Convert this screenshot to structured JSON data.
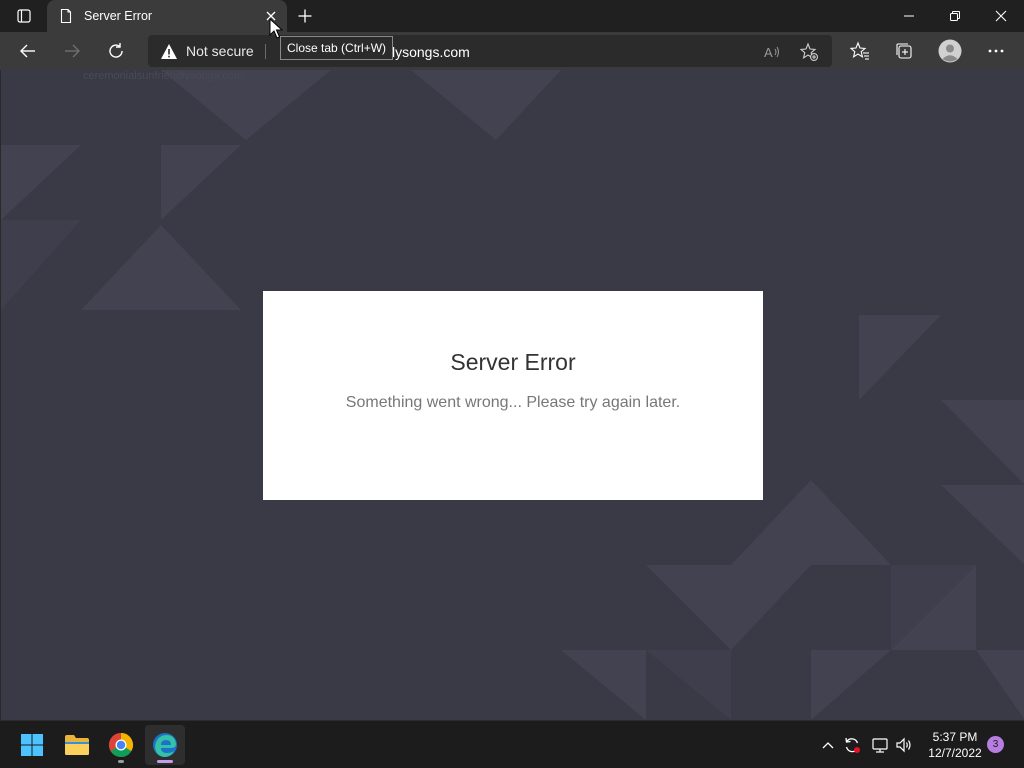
{
  "browser": {
    "tab": {
      "title": "Server Error",
      "icon": "page-icon"
    },
    "tooltip": "Close tab (Ctrl+W)",
    "address_bar": {
      "security_label": "Not secure",
      "url_visible": "lysongs.com",
      "ghost_suggestion": "ceremonialsunfriendlysongs.com"
    },
    "icons": {
      "tab_actions": "tab-actions-icon",
      "close_tab": "close-icon",
      "new_tab": "plus-icon",
      "back": "back-arrow-icon",
      "forward": "forward-arrow-icon",
      "refresh": "refresh-icon",
      "warning": "warning-icon",
      "read_aloud": "read-aloud-icon",
      "add_favorite": "add-favorite-icon",
      "favorites": "favorites-icon",
      "collections": "collections-icon",
      "profile": "profile-icon",
      "more": "more-icon",
      "minimize": "minimize-icon",
      "restore": "restore-icon",
      "close_window": "close-window-icon"
    }
  },
  "page": {
    "title": "Server Error",
    "message": "Something went wrong... Please try again later."
  },
  "taskbar": {
    "apps": [
      "start-icon",
      "file-explorer-icon",
      "chrome-icon",
      "edge-icon"
    ],
    "clock_time": "5:37 PM",
    "clock_date": "12/7/2022",
    "notification_count": "3"
  },
  "colors": {
    "page_bg": "#3a3946",
    "card_bg": "#ffffff",
    "chrome_dark": "#202020",
    "toolbar": "#3b3b3b"
  }
}
